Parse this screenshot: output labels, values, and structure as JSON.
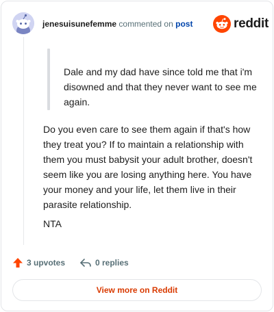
{
  "header": {
    "username": "jenesuisunefemme",
    "action_text": "commented on",
    "post_link": "post",
    "brand_name": "reddit",
    "avatar_icon": "reddit-snoo-avatar-icon"
  },
  "comment": {
    "quote": "Dale and my dad have since told me that i'm disowned and that they never want to see me again.",
    "body": "Do you even care to see them again if that's how they treat you? If to maintain a relationship with them you must babysit your adult brother, doesn't seem like you are losing anything here. You have your money and your life, let them live in their parasite relationship.",
    "verdict": "NTA"
  },
  "footer": {
    "upvotes_label": "3 upvotes",
    "replies_label": "0 replies",
    "view_more_label": "View more on Reddit"
  },
  "colors": {
    "brand_orange": "#ff4500",
    "link_blue": "#0045ac",
    "view_more_text": "#d93a00",
    "muted_text": "#576f76"
  }
}
